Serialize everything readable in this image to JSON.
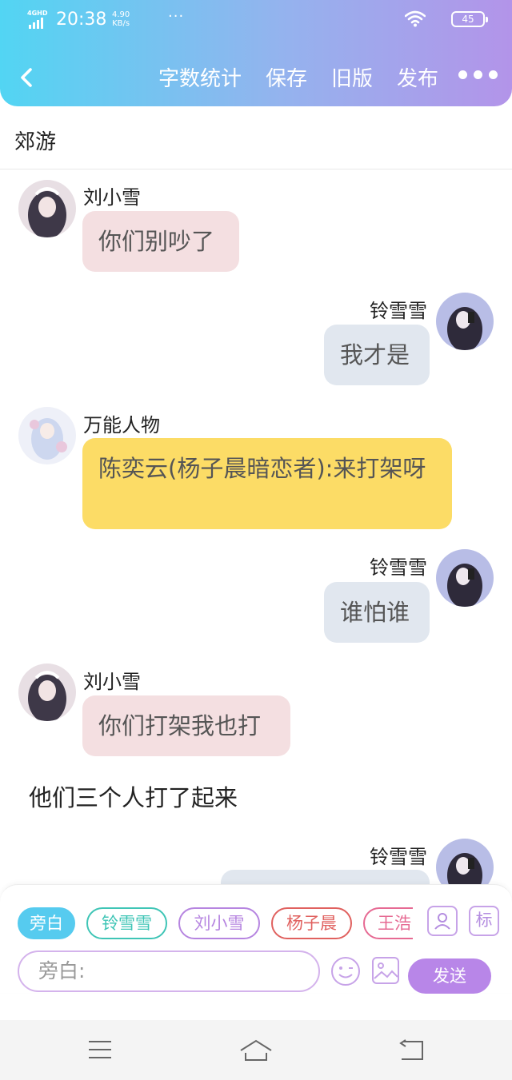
{
  "status_bar": {
    "network": "4GHD",
    "time": "20:38",
    "speed_value": "4.90",
    "speed_unit": "KB/s",
    "more": "···",
    "battery": "45"
  },
  "header": {
    "actions": [
      "字数统计",
      "保存",
      "旧版",
      "发布"
    ]
  },
  "story_title": "郊游",
  "messages": [
    {
      "sender": "刘小雪",
      "text": "你们别吵了"
    },
    {
      "sender": "铃雪雪",
      "text": "我才是"
    },
    {
      "sender": "万能人物",
      "text": "陈奕云(杨子晨暗恋者):来打架呀"
    },
    {
      "sender": "铃雪雪",
      "text": "谁怕谁"
    },
    {
      "sender": "刘小雪",
      "text": "你们打架我也打"
    },
    {
      "narration": "他们三个人打了起来"
    },
    {
      "sender": "铃雪雪",
      "text": ""
    }
  ],
  "role_chips": [
    {
      "label": "旁白",
      "color": "#56cbef",
      "active": true
    },
    {
      "label": "铃雪雪",
      "color": "#3fc5b6"
    },
    {
      "label": "刘小雪",
      "color": "#b685e0"
    },
    {
      "label": "杨子晨",
      "color": "#e0615f"
    },
    {
      "label": "王浩",
      "color": "#e66a93"
    }
  ],
  "toolbar": {
    "mark_label": "标",
    "input_placeholder": "旁白:",
    "send_label": "发送"
  },
  "colors": {
    "header_gradient": [
      "#52d5f3",
      "#b394e9"
    ],
    "bubble_pink": "#f4dfe1",
    "bubble_gray": "#e1e7ef",
    "bubble_yellow": "#fcdc66",
    "send_button": "#b886e8"
  },
  "icons": [
    "back-arrow-icon",
    "more-dots-icon",
    "wifi-icon",
    "battery-icon",
    "character-card-icon",
    "emoji-icon",
    "image-icon",
    "menu-icon",
    "home-icon",
    "back-icon"
  ]
}
